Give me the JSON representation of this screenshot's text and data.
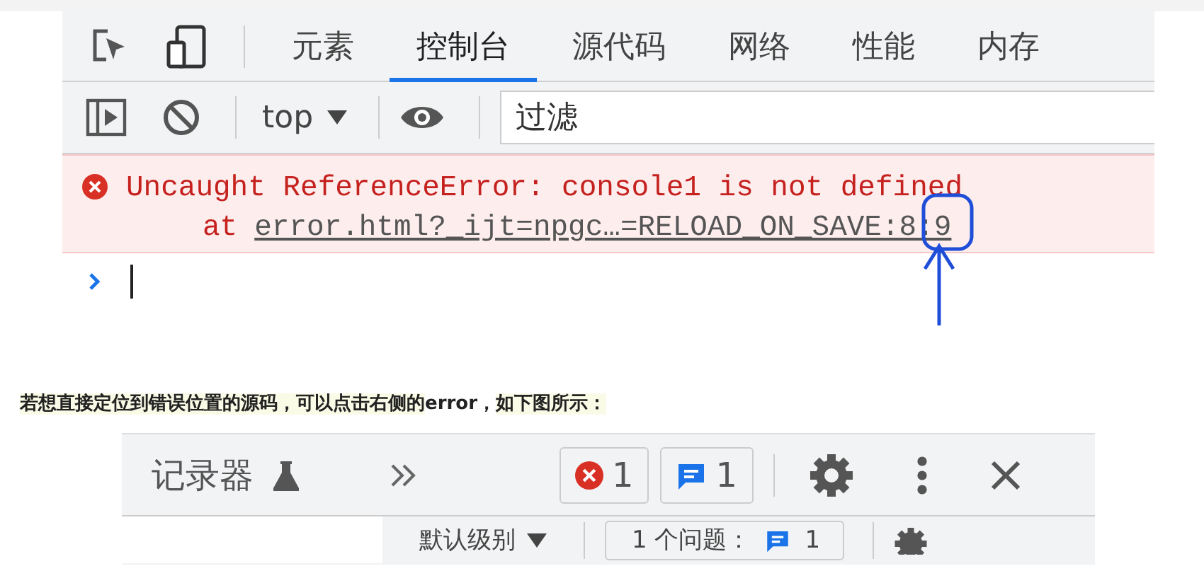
{
  "devtools_console": {
    "tabs": [
      {
        "label": "元素",
        "selected": false
      },
      {
        "label": "控制台",
        "selected": true
      },
      {
        "label": "源代码",
        "selected": false
      },
      {
        "label": "网络",
        "selected": false
      },
      {
        "label": "性能",
        "selected": false
      },
      {
        "label": "内存",
        "selected": false
      }
    ],
    "context": "top",
    "filter_placeholder": "过滤",
    "error": {
      "message": "Uncaught ReferenceError: console1 is not defined",
      "at": "at",
      "link": "error.html?_ijt=npgc…=RELOAD_ON_SAVE:8:9"
    }
  },
  "caption": "**若想直接定位到错误位置的源码，可以点击右侧的**error，**如下图所示：**",
  "devtools_header": {
    "tab": "记录器",
    "error_count": "1",
    "message_count": "1",
    "level": "默认级别",
    "issues_label": "1 个问题：",
    "issues_count": "1"
  }
}
